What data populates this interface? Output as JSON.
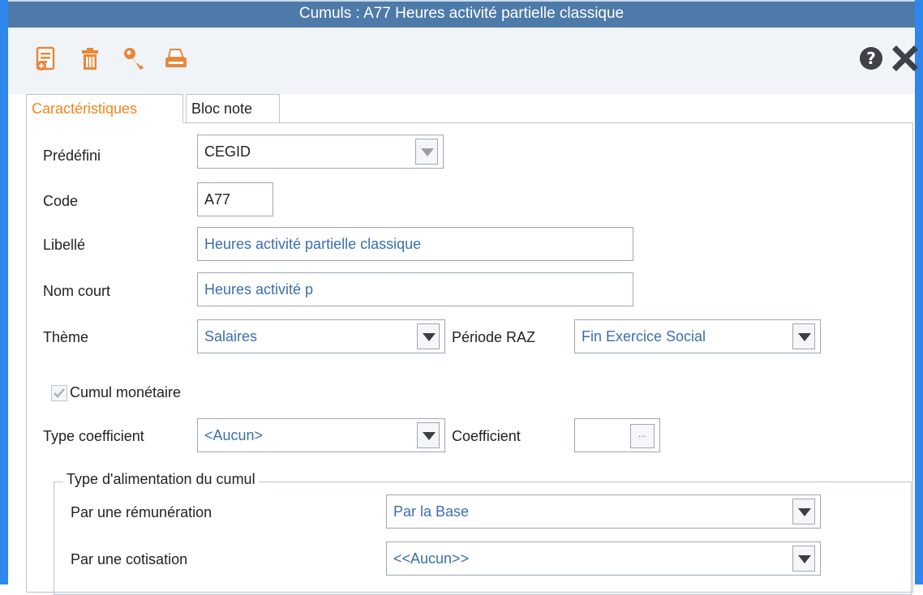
{
  "window": {
    "title": "Cumuls  : A77 Heures activité partielle classique"
  },
  "toolbar": {
    "left_icons": [
      "new-document-icon",
      "trash-icon",
      "key-icon",
      "printer-icon"
    ],
    "right_icons": [
      "help-icon",
      "close-icon"
    ]
  },
  "tabs": [
    {
      "label": "Caractéristiques",
      "active": true
    },
    {
      "label": "Bloc note",
      "active": false
    }
  ],
  "form": {
    "predefini": {
      "label": "Prédéfini",
      "value": "CEGID"
    },
    "code": {
      "label": "Code",
      "value": "A77"
    },
    "libelle": {
      "label": "Libellé",
      "value": "Heures activité partielle classique"
    },
    "nom_court": {
      "label": "Nom court",
      "value": "Heures activité p"
    },
    "theme": {
      "label": "Thème",
      "value": "Salaires"
    },
    "periode_raz": {
      "label": "Période RAZ",
      "value": "Fin Exercice Social"
    },
    "cumul_monetaire": {
      "label": "Cumul monétaire",
      "checked": true
    },
    "type_coefficient": {
      "label": "Type coefficient",
      "value": "<Aucun>"
    },
    "coefficient": {
      "label": "Coefficient",
      "value": "",
      "button": "..."
    }
  },
  "alimentation": {
    "title": "Type d'alimentation du cumul",
    "remuneration": {
      "label": "Par une rémunération",
      "value": "Par la Base"
    },
    "cotisation": {
      "label": "Par une cotisation",
      "value": "<<Aucun>>"
    }
  },
  "colors": {
    "window_border": "#2f86ec",
    "titlebar": "#4d7aa8",
    "active_tab": "#f2861b",
    "field_text": "#3a6fb0",
    "icon_orange": "#e8873a"
  }
}
